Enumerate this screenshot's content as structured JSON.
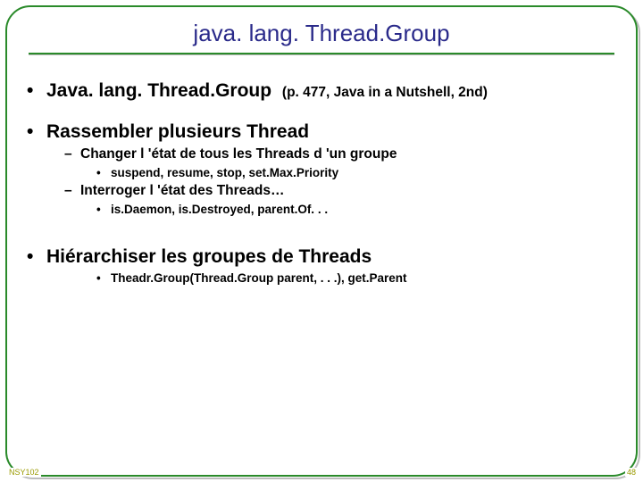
{
  "title": "java. lang. Thread.Group",
  "bullets": {
    "b1a_main": "Java. lang. Thread.Group",
    "b1a_extra": "(p. 477, Java in a Nutshell, 2nd)",
    "b1b": "Rassembler plusieurs Thread",
    "b2a": "Changer l 'état de tous les Threads d 'un groupe",
    "b3a": "suspend, resume, stop, set.Max.Priority",
    "b2b": "Interroger l 'état des Threads…",
    "b3b": "is.Daemon, is.Destroyed, parent.Of. . .",
    "b1c": "Hiérarchiser les groupes de Threads",
    "b3c": "Theadr.Group(Thread.Group parent, . . .), get.Parent"
  },
  "footer": {
    "left": "NSY102",
    "right": "48"
  }
}
